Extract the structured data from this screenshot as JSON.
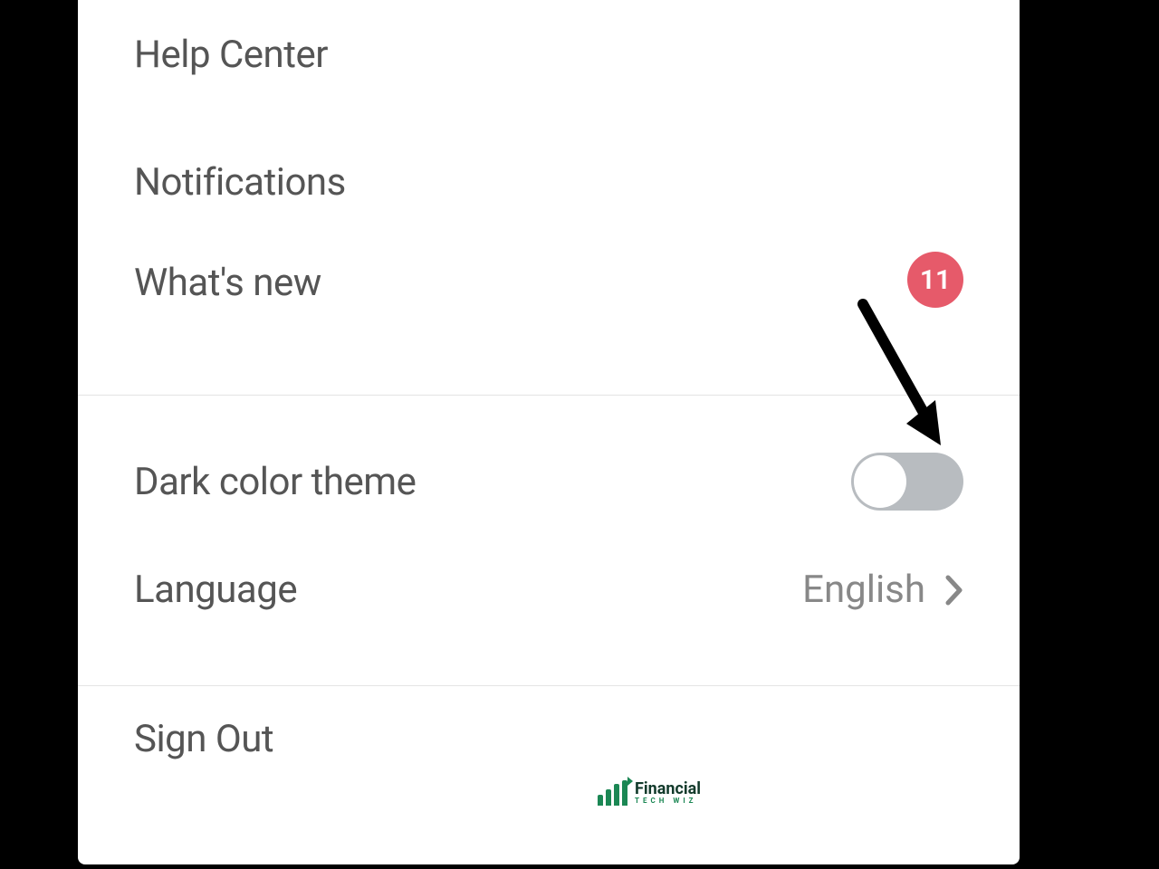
{
  "menu": {
    "help_center": "Help Center",
    "notifications": "Notifications",
    "whats_new": {
      "label": "What's new",
      "badge": "11"
    },
    "dark_theme": {
      "label": "Dark color theme",
      "on": false
    },
    "language": {
      "label": "Language",
      "value": "English"
    },
    "sign_out": "Sign Out"
  },
  "watermark": {
    "brand": "Financial",
    "sub": "TECH WIZ"
  },
  "colors": {
    "badge": "#e65a6a",
    "toggle_track": "#b8bcc0",
    "text": "#555",
    "brand": "#1b8754"
  }
}
